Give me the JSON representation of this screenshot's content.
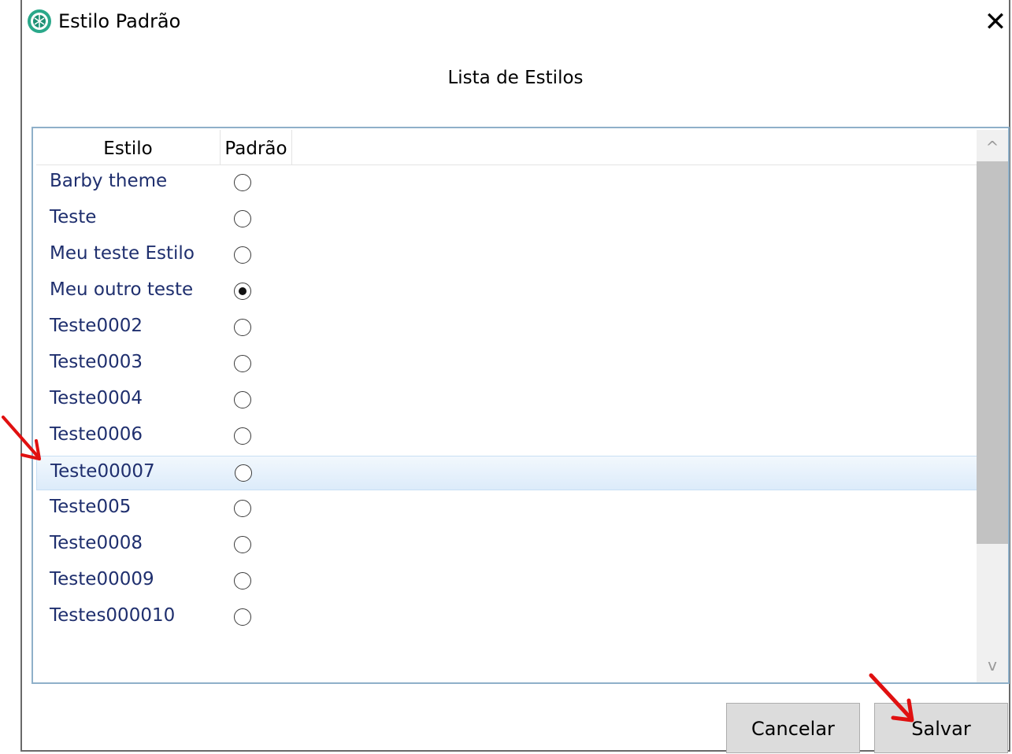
{
  "window": {
    "title": "Estilo Padrão",
    "close_symbol": "✕"
  },
  "heading": "Lista de Estilos",
  "table": {
    "columns": [
      "Estilo",
      "Padrão"
    ],
    "rows": [
      {
        "name": "Barby theme",
        "default": false
      },
      {
        "name": "Teste",
        "default": false
      },
      {
        "name": "Meu teste Estilo",
        "default": false
      },
      {
        "name": "Meu outro teste",
        "default": true
      },
      {
        "name": "Teste0002",
        "default": false
      },
      {
        "name": "Teste0003",
        "default": false
      },
      {
        "name": "Teste0004",
        "default": false
      },
      {
        "name": "Teste0006",
        "default": false
      },
      {
        "name": "Teste00007",
        "default": false
      },
      {
        "name": "Teste005",
        "default": false
      },
      {
        "name": "Teste0008",
        "default": false
      },
      {
        "name": "Teste00009",
        "default": false
      },
      {
        "name": "Testes000010",
        "default": false
      }
    ]
  },
  "scrollbar": {
    "up_symbol": "^",
    "down_symbol": "v"
  },
  "buttons": {
    "cancel": "Cancelar",
    "save": "Salvar"
  },
  "colors": {
    "item_text": "#1f2f6e",
    "annotation_arrow": "#e01010",
    "hover_row": "#dcebfa"
  }
}
